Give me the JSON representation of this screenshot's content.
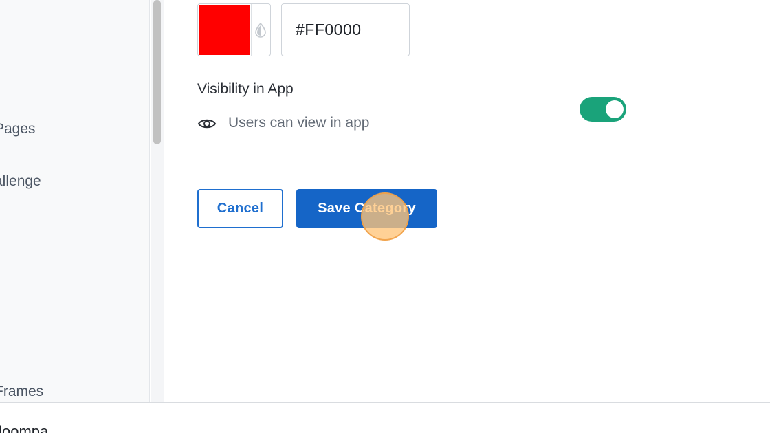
{
  "sidebar": {
    "items": [
      {
        "label": "Pages"
      },
      {
        "label": "allenge"
      },
      {
        "label": "Frames"
      }
    ]
  },
  "form": {
    "color": {
      "swatch_color": "#FF0000",
      "hex_value": "#FF0000",
      "picker_icon": "droplet-icon"
    },
    "visibility": {
      "title": "Visibility in App",
      "description": "Users can view in app",
      "icon": "eye-icon",
      "toggle_on": true,
      "toggle_color": "#1AA37A"
    },
    "actions": {
      "cancel_label": "Cancel",
      "save_label": "Save Category",
      "primary_color": "#1565C7"
    }
  },
  "footer": {
    "text": "Joompa"
  }
}
